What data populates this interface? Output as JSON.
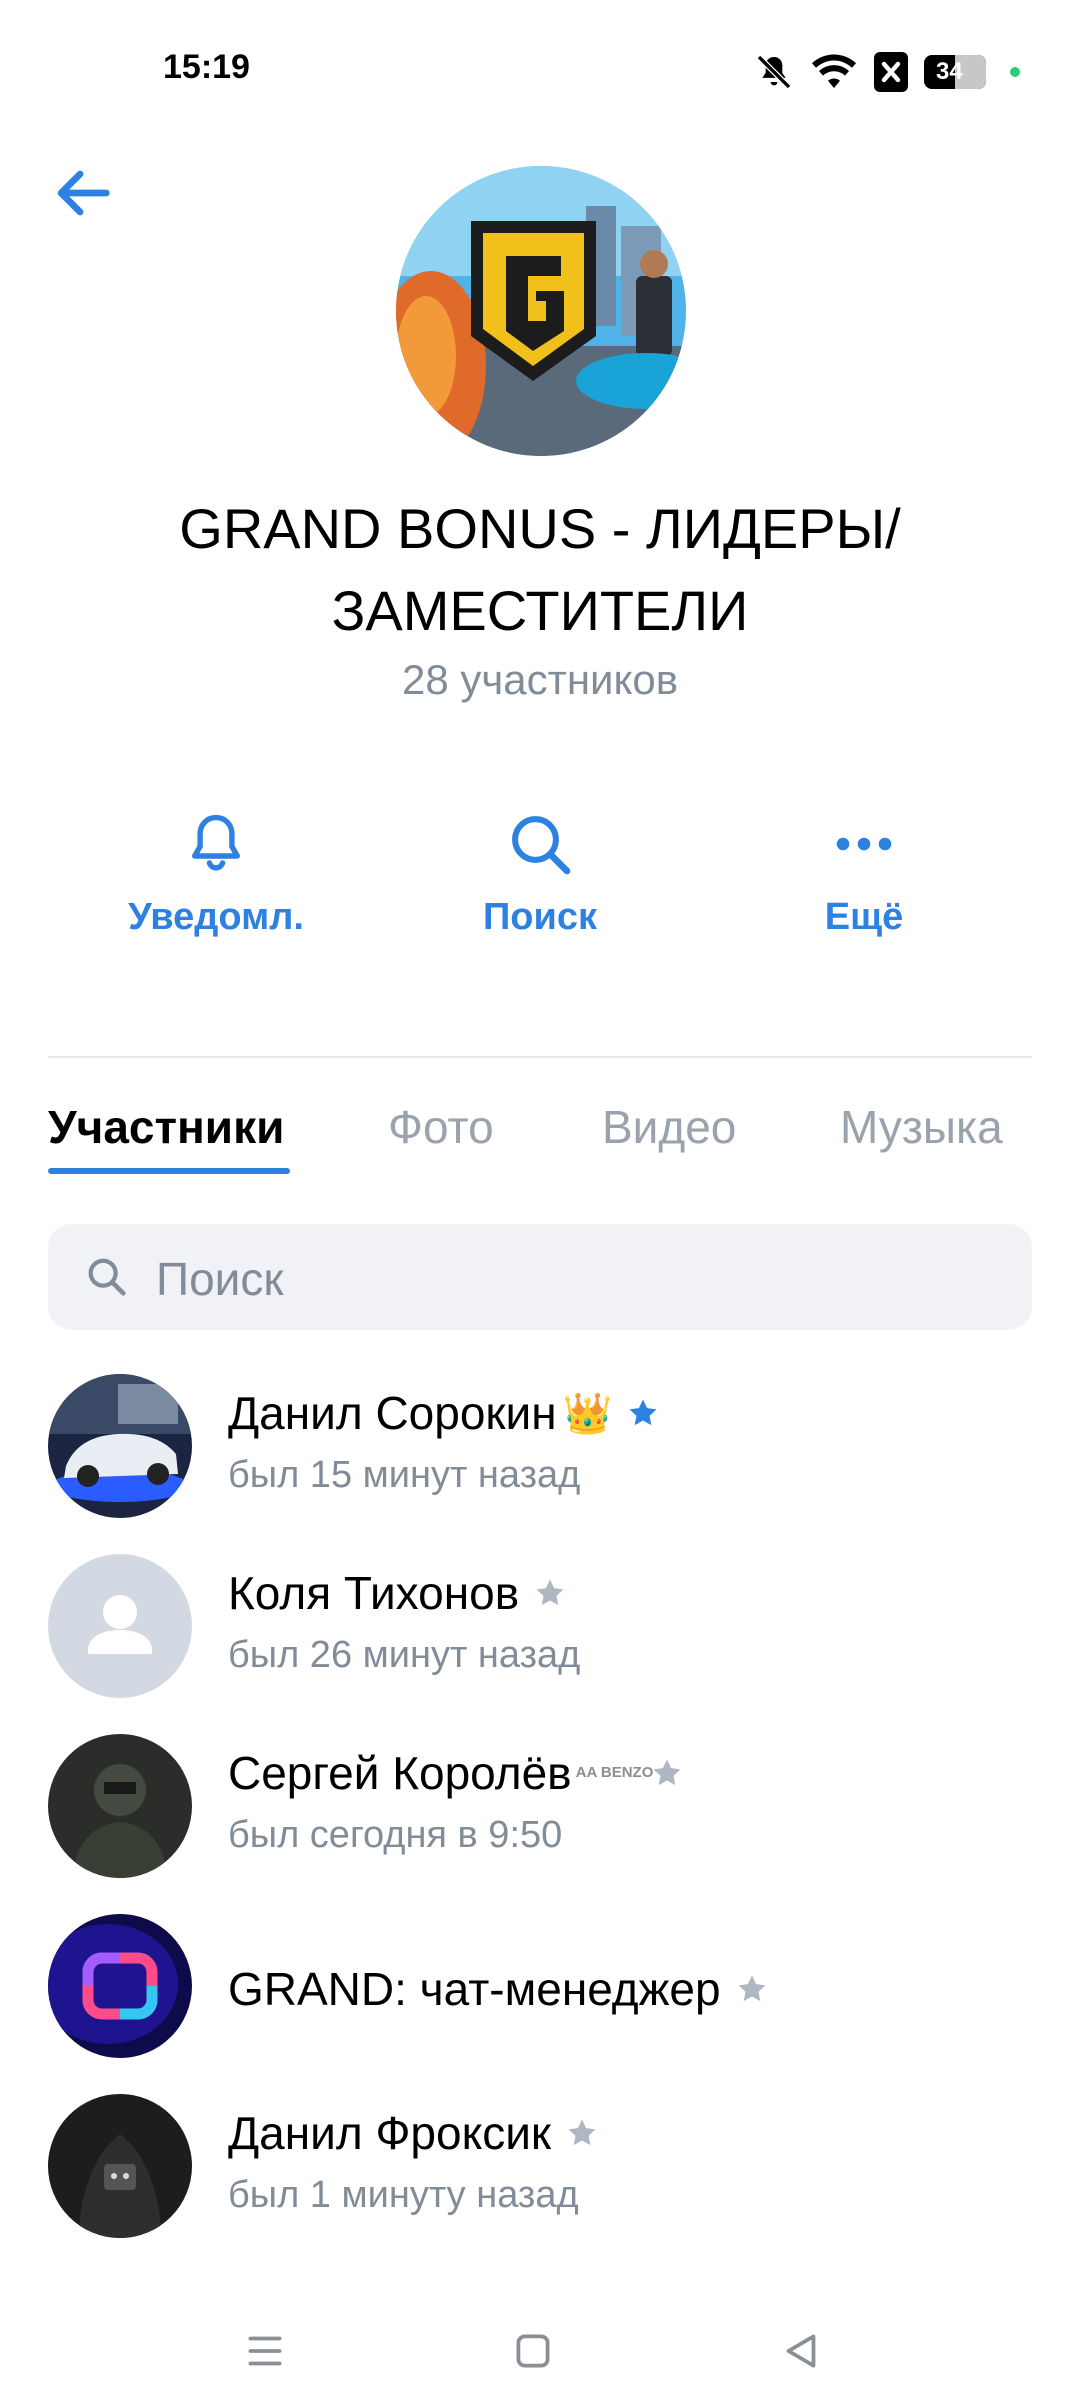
{
  "status_bar": {
    "time": "15:19",
    "battery": "34"
  },
  "header": {
    "title": "GRAND BONUS - ЛИДЕРЫ/ ЗАМЕСТИТЕЛИ",
    "members_count": "28 участников",
    "avatar_icon": "grand-logo-icon"
  },
  "actions": {
    "notifications_label": "Уведомл.",
    "search_label": "Поиск",
    "more_label": "Ещё"
  },
  "tabs": [
    {
      "label": "Участники",
      "active": true
    },
    {
      "label": "Фото",
      "active": false
    },
    {
      "label": "Видео",
      "active": false
    },
    {
      "label": "Музыка",
      "active": false
    }
  ],
  "search": {
    "placeholder": "Поиск"
  },
  "members": [
    {
      "name": "Данил Сорокин",
      "badge": "👑",
      "status": "был 15 минут назад",
      "star_color": "#2d81e0"
    },
    {
      "name": "Коля Тихонов",
      "badge": "",
      "status": "был 26 минут назад",
      "star_color": "#aeb7c2"
    },
    {
      "name": "Сергей Королёв",
      "badge": "AA BENZO",
      "status": "был сегодня в 9:50",
      "star_color": "#aeb7c2"
    },
    {
      "name": "GRAND: чат-менеджер",
      "badge": "",
      "status": "",
      "star_color": "#aeb7c2"
    },
    {
      "name": "Данил Фроксик",
      "badge": "",
      "status": "был 1 минуту назад",
      "star_color": "#aeb7c2"
    }
  ],
  "colors": {
    "accent": "#2d81e0",
    "secondary_text": "#818c99",
    "tab_inactive": "#99a2ad"
  }
}
